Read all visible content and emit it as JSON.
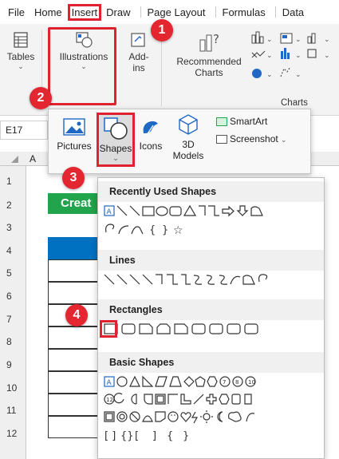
{
  "menu": {
    "items": [
      "File",
      "Home",
      "Insert",
      "Draw",
      "Page Layout",
      "Formulas",
      "Data"
    ]
  },
  "ribbon": {
    "tables_label": "Tables",
    "illustrations_label": "Illustrations",
    "addins_label": "Add-ins",
    "recommended_charts_label": "Recommended Charts",
    "charts_group_label": "Charts"
  },
  "namebox": {
    "value": "E17"
  },
  "grid": {
    "column_a": "A",
    "rows": [
      "1",
      "2",
      "3",
      "4",
      "5",
      "6",
      "7",
      "8",
      "9",
      "10",
      "11",
      "12"
    ],
    "green_cell_text": "Creat"
  },
  "illustrations_menu": {
    "pictures": "Pictures",
    "shapes": "Shapes",
    "icons": "Icons",
    "models_3d": "3D Models",
    "smartart": "SmartArt",
    "screenshot": "Screenshot"
  },
  "shapes_menu": {
    "sections": [
      "Recently Used Shapes",
      "Lines",
      "Rectangles",
      "Basic Shapes"
    ]
  },
  "callouts": [
    "1",
    "2",
    "3",
    "4"
  ],
  "colors": {
    "accent_red": "#e0212f",
    "excel_green": "#21a44b",
    "header_blue": "#0070c0"
  },
  "icons": [
    "table-icon",
    "illustrations-icon",
    "addins-icon",
    "recommended-charts-icon",
    "pictures-icon",
    "shapes-icon",
    "icons-icon",
    "3d-models-icon",
    "smartart-icon",
    "screenshot-icon"
  ]
}
